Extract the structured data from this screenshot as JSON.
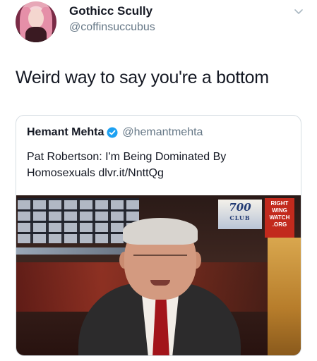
{
  "author": {
    "display_name": "Gothicc Scully",
    "handle": "@coffinsuccubus"
  },
  "tweet": {
    "text": "Weird way to say you're a bottom"
  },
  "quoted_tweet": {
    "display_name": "Hemant Mehta",
    "handle": "@hemantmehta",
    "text": "Pat Robertson: I'm Being Dominated By Homosexuals dlvr.it/NnttQg",
    "media": {
      "logo_700": "700",
      "logo_700_sub": "CLUB",
      "watermark_lines": [
        "RIGHT",
        "WING",
        "WATCH",
        ".ORG"
      ]
    }
  },
  "icons": {
    "menu": "chevron-down-icon",
    "verified": "verified-badge-icon"
  },
  "colors": {
    "text_primary": "#141823",
    "text_secondary": "#657786",
    "verified_blue": "#1da1f2",
    "card_border": "#d6dde3"
  }
}
